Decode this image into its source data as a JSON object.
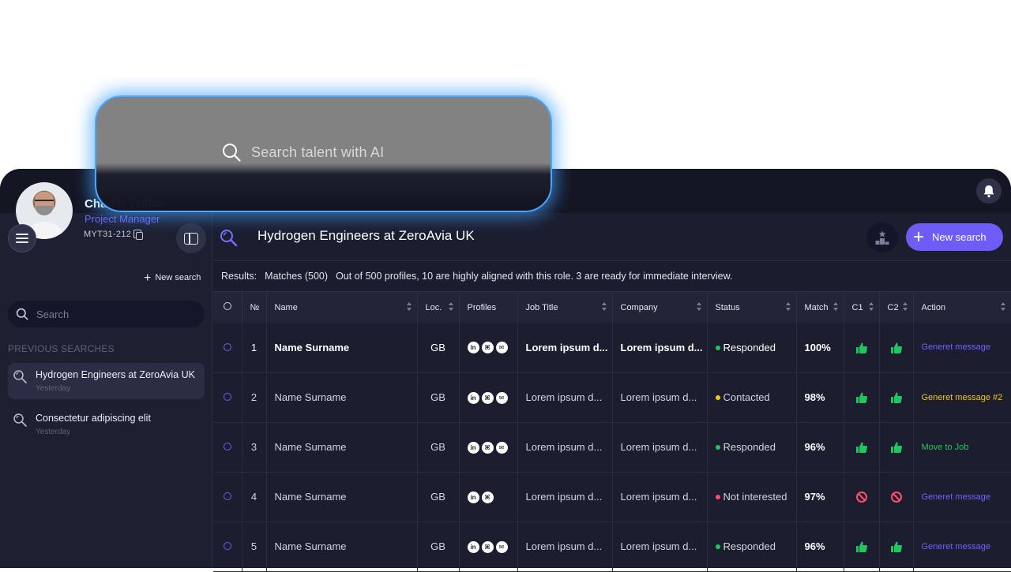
{
  "user": {
    "name": "Charlie Yellow",
    "role": "Project Manager",
    "id": "MYT31-212"
  },
  "sidebar": {
    "new_search_label": "New search",
    "search_placeholder": "Search",
    "previous_searches_label": "PREVIOUS SEARCHES",
    "items": [
      {
        "title": "Hydrogen Engineers at ZeroAvia UK",
        "date": "Yesterday",
        "active": true
      },
      {
        "title": "Consectetur adipiscing elit",
        "date": "Yesterday",
        "active": false
      }
    ]
  },
  "ai_search": {
    "placeholder": "Search talent with AI"
  },
  "header": {
    "title": "Hydrogen Engineers at ZeroAvia UK",
    "new_search_label": "New search"
  },
  "results": {
    "label": "Results:",
    "matches": "Matches (500)",
    "summary": "Out of 500 profiles, 10 are highly aligned with this role. 3 are ready for immediate interview."
  },
  "table": {
    "columns": [
      "",
      "№",
      "Name",
      "Loc.",
      "Profiles",
      "Job Title",
      "Company",
      "Status",
      "Match",
      "C1",
      "C2",
      "Action"
    ],
    "rows": [
      {
        "num": "1",
        "name": "Name Surname",
        "loc": "GB",
        "profiles": [
          "linkedin",
          "github",
          "email"
        ],
        "job": "Lorem ipsum d...",
        "company": "Lorem ipsum d...",
        "status": "Responded",
        "status_color": "#22c55e",
        "match": "100%",
        "c1": "thumb-up",
        "c2": "thumb-up",
        "action": "Generet message",
        "action_color": "#6e63ff"
      },
      {
        "num": "2",
        "name": "Name Surname",
        "loc": "GB",
        "profiles": [
          "linkedin",
          "github",
          "email"
        ],
        "job": "Lorem ipsum d...",
        "company": "Lorem ipsum d...",
        "status": "Contacted",
        "status_color": "#f5c518",
        "match": "98%",
        "c1": "thumb-up",
        "c2": "thumb-up",
        "action": "Generet message #2",
        "action_color": "#f5c518"
      },
      {
        "num": "3",
        "name": "Name Surname",
        "loc": "GB",
        "profiles": [
          "linkedin",
          "github",
          "email"
        ],
        "job": "Lorem ipsum d...",
        "company": "Lorem ipsum d...",
        "status": "Responded",
        "status_color": "#22c55e",
        "match": "96%",
        "c1": "thumb-up",
        "c2": "thumb-up",
        "action": "Move to Job",
        "action_color": "#22c55e"
      },
      {
        "num": "4",
        "name": "Name Surname",
        "loc": "GB",
        "profiles": [
          "linkedin",
          "github"
        ],
        "job": "Lorem ipsum d...",
        "company": "Lorem ipsum d...",
        "status": "Not interested",
        "status_color": "#ff4d6d",
        "match": "97%",
        "c1": "ban",
        "c2": "ban",
        "action": "Generet message",
        "action_color": "#6e63ff"
      },
      {
        "num": "5",
        "name": "Name Surname",
        "loc": "GB",
        "profiles": [
          "linkedin",
          "github",
          "email"
        ],
        "job": "Lorem ipsum d...",
        "company": "Lorem ipsum d...",
        "status": "Responded",
        "status_color": "#22c55e",
        "match": "96%",
        "c1": "thumb-up",
        "c2": "thumb-up",
        "action": "Generet message",
        "action_color": "#6e63ff"
      }
    ]
  },
  "colors": {
    "accent": "#6e5cf6",
    "glow": "#48a8ff",
    "positive": "#22c55e"
  }
}
